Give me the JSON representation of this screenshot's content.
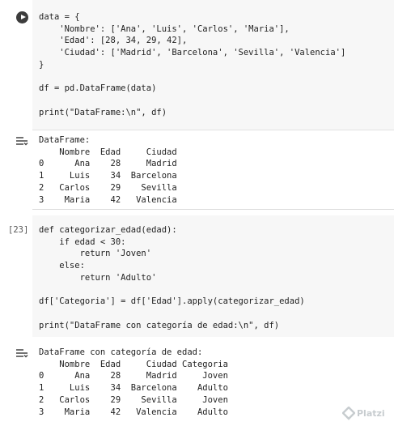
{
  "cell1": {
    "code": [
      "data = {",
      "    'Nombre': ['Ana', 'Luis', 'Carlos', 'Maria'],",
      "    'Edad': [28, 34, 29, 42],",
      "    'Ciudad': ['Madrid', 'Barcelona', 'Sevilla', 'Valencia']",
      "}",
      "",
      "df = pd.DataFrame(data)",
      "",
      "print(\"DataFrame:\\n\", df)"
    ],
    "output": [
      "DataFrame:",
      "    Nombre  Edad     Ciudad",
      "0      Ana    28     Madrid",
      "1     Luis    34  Barcelona",
      "2   Carlos    29    Sevilla",
      "3    Maria    42   Valencia"
    ]
  },
  "cell2": {
    "exec_count": "[23]",
    "code": [
      "def categorizar_edad(edad):",
      "    if edad < 30:",
      "        return 'Joven'",
      "    else:",
      "        return 'Adulto'",
      "",
      "df['Categoria'] = df['Edad'].apply(categorizar_edad)",
      "",
      "print(\"DataFrame con categoría de edad:\\n\", df)"
    ],
    "output": [
      "DataFrame con categoría de edad:",
      "    Nombre  Edad     Ciudad Categoria",
      "0      Ana    28     Madrid     Joven",
      "1     Luis    34  Barcelona    Adulto",
      "2   Carlos    29    Sevilla     Joven",
      "3    Maria    42   Valencia    Adulto"
    ]
  },
  "watermark": "Platzi",
  "icons": {
    "run": "play-icon",
    "output": "output-collapse-icon",
    "logo": "platzi-logo-icon"
  }
}
